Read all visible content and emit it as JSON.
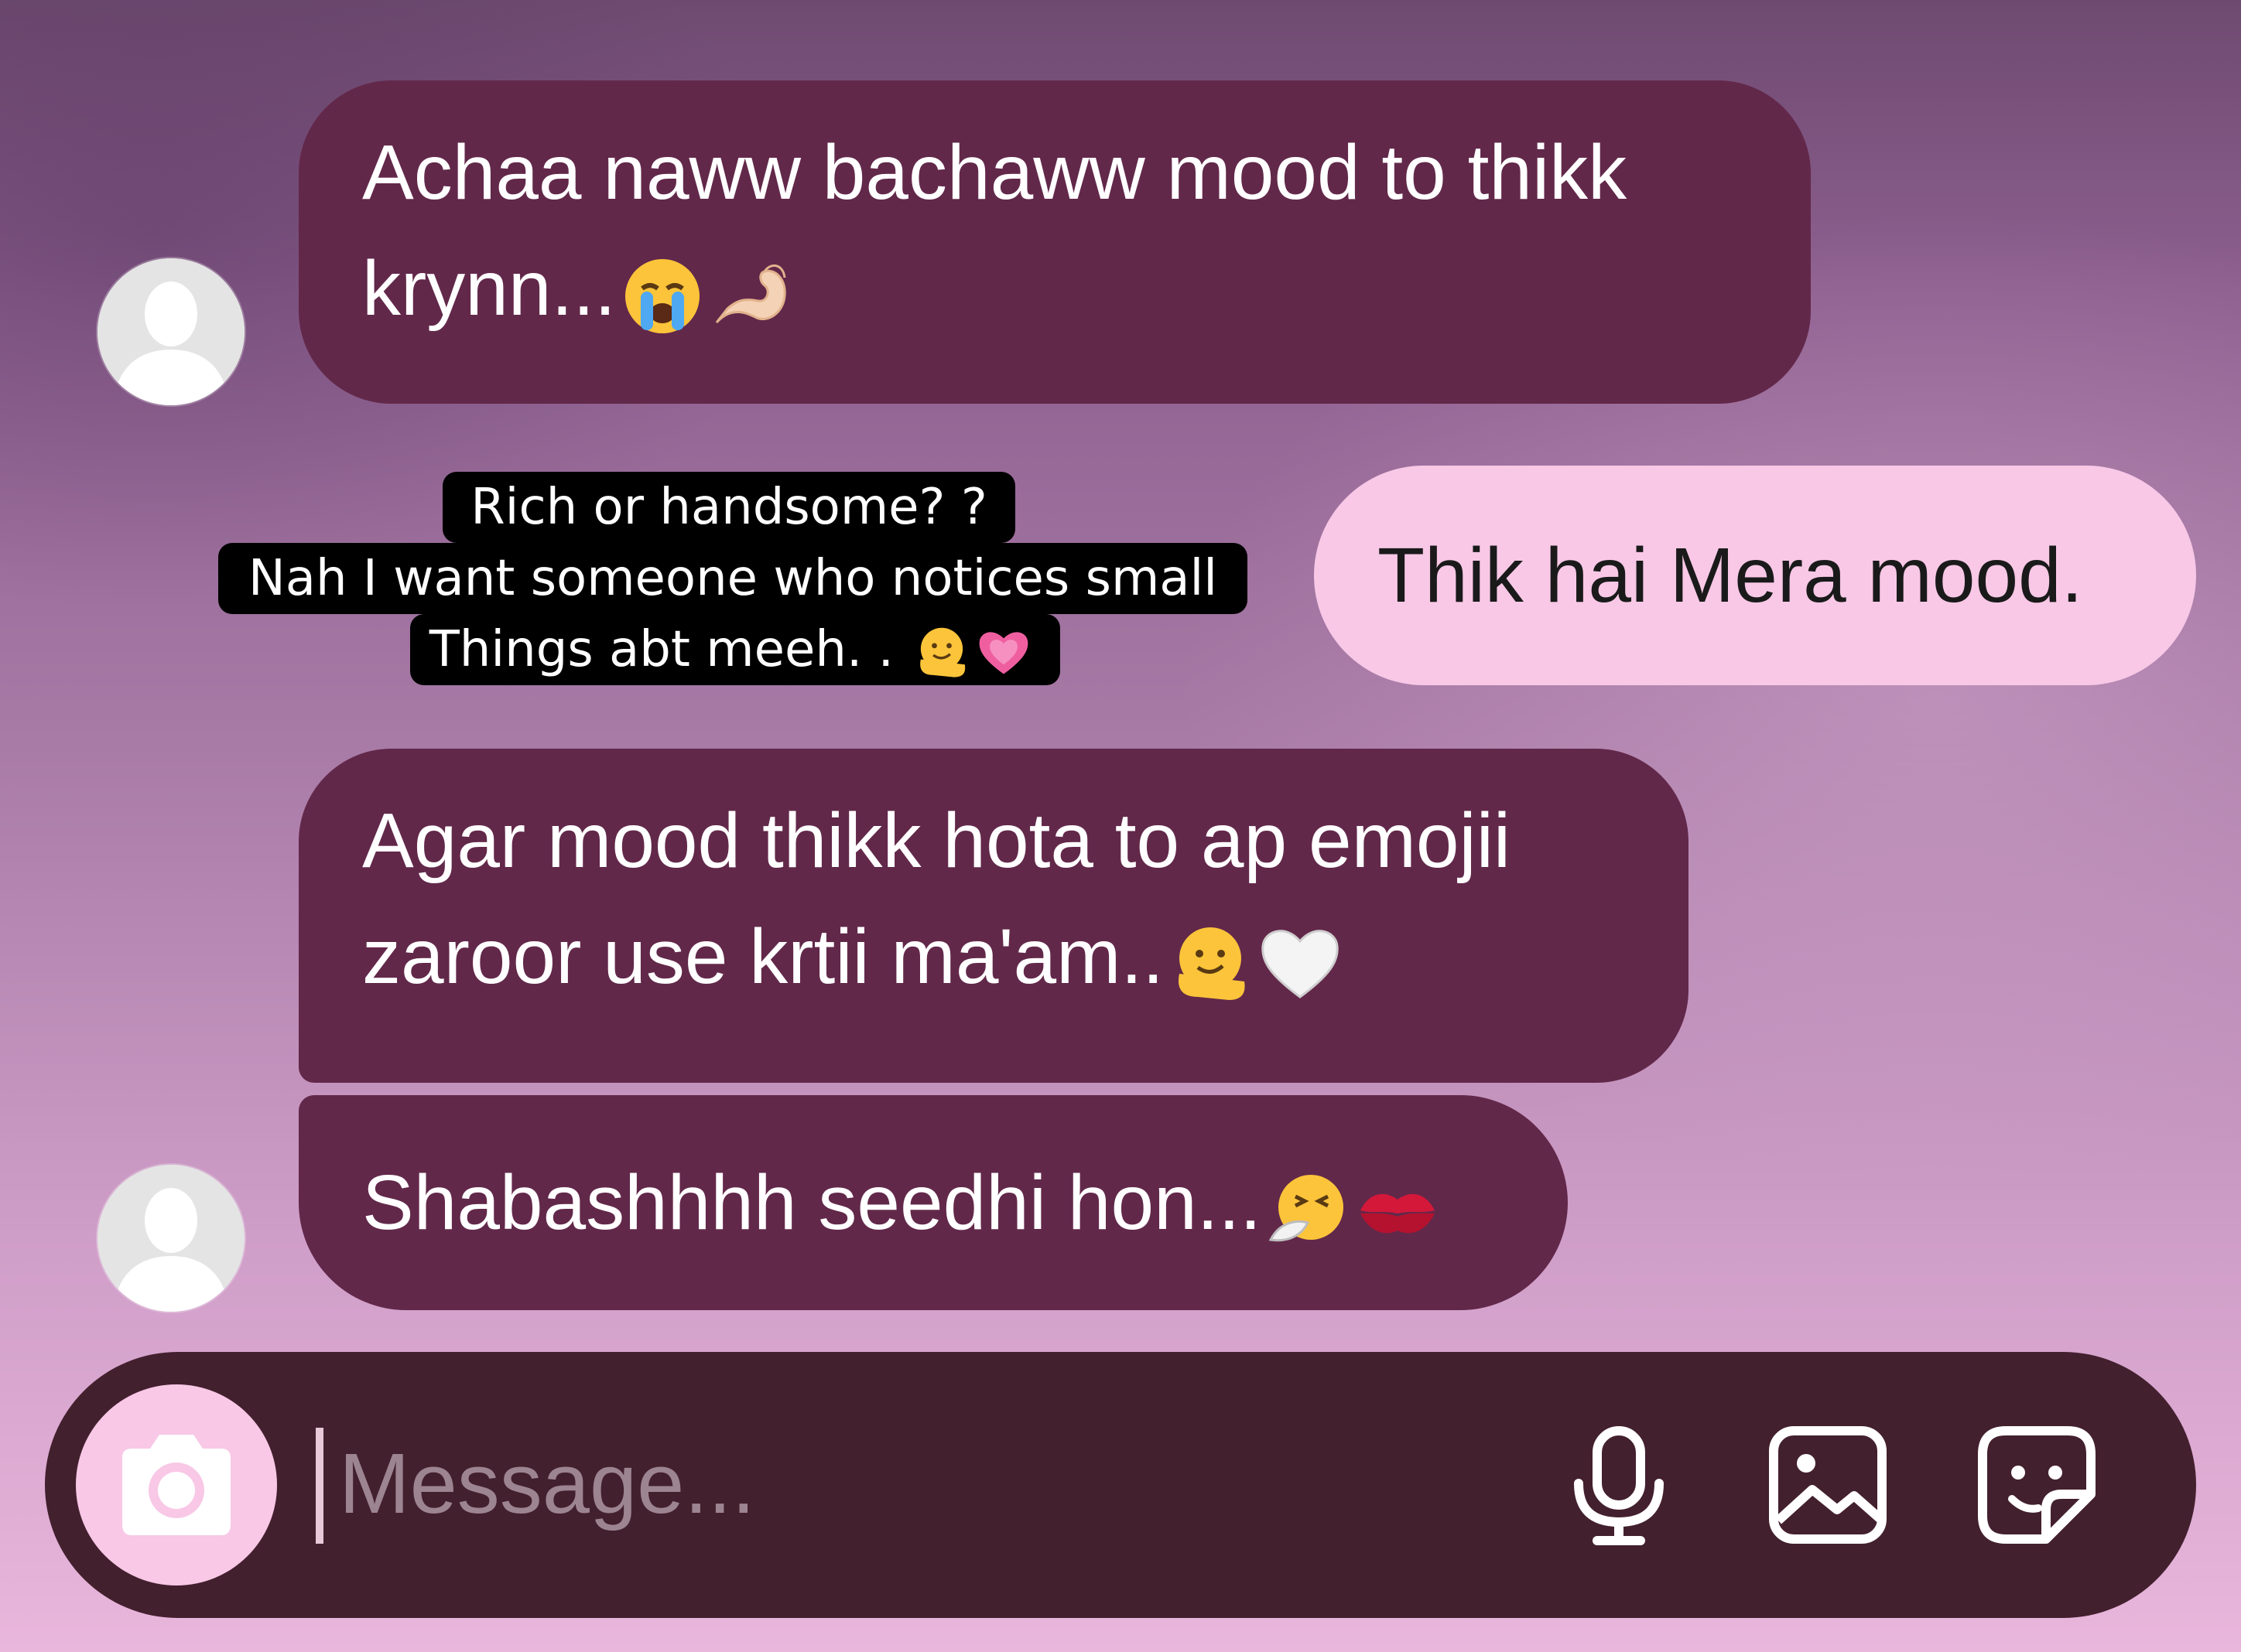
{
  "messages": [
    {
      "sender": "other",
      "text_line1": "Achaa naww bachaww mood to thikk",
      "text_line2": "krynn...",
      "emojis": [
        "loudly-crying-face-emoji",
        "pinching-hand-emoji"
      ]
    },
    {
      "sender": "me",
      "text": "Thik hai Mera mood."
    },
    {
      "sender": "other",
      "text_line1": "Agar mood thikk hota to ap emojii",
      "text_line2": "zaroor use krtii ma'am..",
      "emojis": [
        "melting-face-emoji",
        "white-heart-emoji"
      ]
    },
    {
      "sender": "other",
      "text": "Shabashhhh seedhi hon...",
      "emojis": [
        "sneezing-face-emoji",
        "kiss-mark-emoji"
      ]
    }
  ],
  "sticker": {
    "line1": "Rich or handsome? ?",
    "line2": "Nah I want someone who notices small",
    "line3": "Things abt meeh. . ",
    "emojis": [
      "melting-face-emoji",
      "growing-heart-emoji"
    ]
  },
  "composer": {
    "placeholder": "Message...",
    "icons": [
      "camera-icon",
      "microphone-icon",
      "gallery-icon",
      "sticker-icon"
    ]
  },
  "colors": {
    "incoming_bubble": "#62284a",
    "outgoing_bubble": "#f8c8e6",
    "composer_bar": "#43202e",
    "camera_button": "#f8c8e6"
  }
}
